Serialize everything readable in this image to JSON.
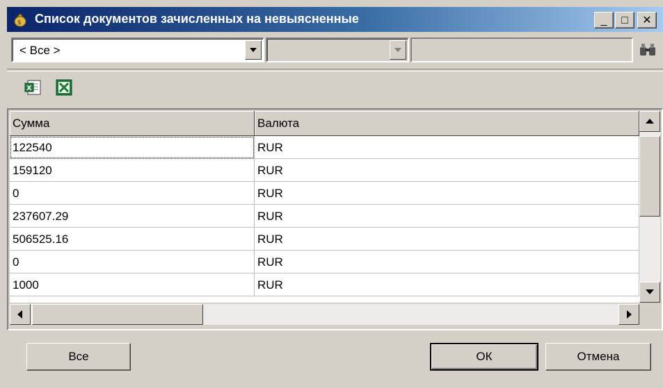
{
  "window": {
    "title": "Список документов зачисленных на невыясненные",
    "min_glyph": "_",
    "max_glyph": "□",
    "close_glyph": "✕"
  },
  "filters": {
    "combo1_value": "< Все >",
    "combo2_value": "",
    "search_value": "",
    "search_icon": "binoculars-icon"
  },
  "toolbar": {
    "buttons": [
      {
        "icon": "excel-export-icon"
      },
      {
        "icon": "excel-icon"
      }
    ]
  },
  "table": {
    "columns": [
      "Сумма",
      "Валюта"
    ],
    "rows": [
      [
        "122540",
        "RUR"
      ],
      [
        "159120",
        "RUR"
      ],
      [
        "0",
        "RUR"
      ],
      [
        "237607.29",
        "RUR"
      ],
      [
        "506525.16",
        "RUR"
      ],
      [
        "0",
        "RUR"
      ],
      [
        "1000",
        "RUR"
      ]
    ]
  },
  "buttons": {
    "all_label": "Все",
    "ok_label": "ОК",
    "cancel_label": "Отмена"
  }
}
